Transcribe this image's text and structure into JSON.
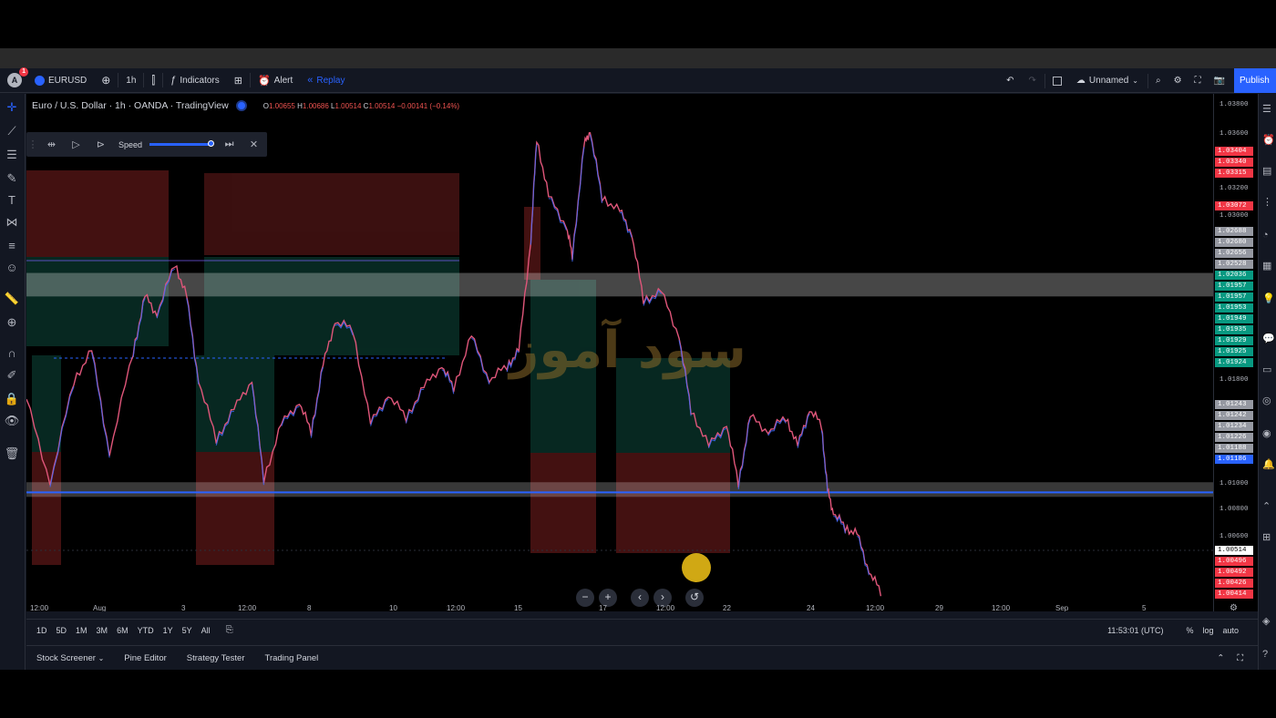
{
  "toolbar": {
    "avatar_letter": "A",
    "avatar_badge": "1",
    "symbol": "EURUSD",
    "interval": "1h",
    "indicators_label": "Indicators",
    "alert_label": "Alert",
    "replay_label": "Replay",
    "layout_name": "Unnamed",
    "publish_label": "Publish"
  },
  "legend": {
    "title": "Euro / U.S. Dollar · 1h · OANDA · TradingView",
    "o_label": "O",
    "o": "1.00655",
    "h_label": "H",
    "h": "1.00686",
    "l_label": "L",
    "l": "1.00514",
    "c_label": "C",
    "c": "1.00514",
    "change": "−0.00141 (−0.14%)"
  },
  "replay_bar": {
    "speed_label": "Speed",
    "speed_level": 1.0
  },
  "watermark": "سود آموز",
  "chart_data": {
    "type": "line",
    "ylim": [
      1.004,
      1.0385
    ],
    "price_ticks": [
      "1.03800",
      "1.03600",
      "1.03200",
      "1.03000",
      "1.01800",
      "1.01000",
      "1.00800",
      "1.00600"
    ],
    "price_tags": [
      {
        "v": "1.03404",
        "c": "#f23645"
      },
      {
        "v": "1.03340",
        "c": "#f23645"
      },
      {
        "v": "1.03315",
        "c": "#f23645"
      },
      {
        "v": "1.03072",
        "c": "#f23645"
      },
      {
        "v": "1.02688",
        "c": "#9598a1"
      },
      {
        "v": "1.02680",
        "c": "#9598a1"
      },
      {
        "v": "1.02656",
        "c": "#9598a1"
      },
      {
        "v": "1.02528",
        "c": "#9598a1"
      },
      {
        "v": "1.02036",
        "c": "#089981"
      },
      {
        "v": "1.01957",
        "c": "#089981"
      },
      {
        "v": "1.01957",
        "c": "#089981"
      },
      {
        "v": "1.01953",
        "c": "#089981"
      },
      {
        "v": "1.01949",
        "c": "#089981"
      },
      {
        "v": "1.01935",
        "c": "#089981"
      },
      {
        "v": "1.01929",
        "c": "#089981"
      },
      {
        "v": "1.01925",
        "c": "#089981"
      },
      {
        "v": "1.01924",
        "c": "#089981"
      },
      {
        "v": "1.01243",
        "c": "#9598a1"
      },
      {
        "v": "1.01242",
        "c": "#9598a1"
      },
      {
        "v": "1.01234",
        "c": "#9598a1"
      },
      {
        "v": "1.01226",
        "c": "#9598a1"
      },
      {
        "v": "1.01188",
        "c": "#9598a1"
      },
      {
        "v": "1.01186",
        "c": "#2962ff"
      },
      {
        "v": "1.00514",
        "c": "#ffffff"
      },
      {
        "v": "1.00496",
        "c": "#f23645"
      },
      {
        "v": "1.00492",
        "c": "#f23645"
      },
      {
        "v": "1.00426",
        "c": "#f23645"
      },
      {
        "v": "1.00414",
        "c": "#f23645"
      }
    ],
    "time_ticks": [
      "12:00",
      "Aug",
      "3",
      "12:00",
      "8",
      "10",
      "12:00",
      "15",
      "17",
      "12:00",
      "22",
      "24",
      "12:00",
      "29",
      "12:00",
      "Sep",
      "5"
    ],
    "price_path": [
      [
        0,
        1.0182
      ],
      [
        0.02,
        1.0125
      ],
      [
        0.04,
        1.0195
      ],
      [
        0.055,
        1.0215
      ],
      [
        0.07,
        1.0145
      ],
      [
        0.09,
        1.0215
      ],
      [
        0.1,
        1.0252
      ],
      [
        0.11,
        1.024
      ],
      [
        0.125,
        1.0275
      ],
      [
        0.135,
        1.0252
      ],
      [
        0.145,
        1.0195
      ],
      [
        0.16,
        1.0155
      ],
      [
        0.175,
        1.0175
      ],
      [
        0.19,
        1.0195
      ],
      [
        0.2,
        1.0128
      ],
      [
        0.215,
        1.0165
      ],
      [
        0.23,
        1.018
      ],
      [
        0.24,
        1.016
      ],
      [
        0.25,
        1.0205
      ],
      [
        0.26,
        1.0235
      ],
      [
        0.275,
        1.023
      ],
      [
        0.29,
        1.0165
      ],
      [
        0.305,
        1.0185
      ],
      [
        0.32,
        1.017
      ],
      [
        0.335,
        1.019
      ],
      [
        0.35,
        1.0205
      ],
      [
        0.36,
        1.019
      ],
      [
        0.375,
        1.0225
      ],
      [
        0.39,
        1.0195
      ],
      [
        0.405,
        1.0205
      ],
      [
        0.415,
        1.0215
      ],
      [
        0.425,
        1.029
      ],
      [
        0.43,
        1.036
      ],
      [
        0.44,
        1.032
      ],
      [
        0.455,
        1.03
      ],
      [
        0.46,
        1.028
      ],
      [
        0.47,
        1.0355
      ],
      [
        0.475,
        1.0365
      ],
      [
        0.485,
        1.032
      ],
      [
        0.5,
        1.031
      ],
      [
        0.51,
        1.0295
      ],
      [
        0.52,
        1.025
      ],
      [
        0.535,
        1.0255
      ],
      [
        0.55,
        1.0225
      ],
      [
        0.56,
        1.0175
      ],
      [
        0.575,
        1.015
      ],
      [
        0.59,
        1.0165
      ],
      [
        0.6,
        1.0125
      ],
      [
        0.61,
        1.017
      ],
      [
        0.625,
        1.016
      ],
      [
        0.64,
        1.017
      ],
      [
        0.65,
        1.015
      ],
      [
        0.66,
        1.0175
      ],
      [
        0.67,
        1.0165
      ],
      [
        0.675,
        1.012
      ],
      [
        0.68,
        1.0105
      ],
      [
        0.69,
        1.0095
      ],
      [
        0.7,
        1.009
      ],
      [
        0.71,
        1.0065
      ],
      [
        0.72,
        1.0051
      ]
    ]
  },
  "zones": {
    "supply_band": {
      "top": 1.0268,
      "bottom": 1.0252
    },
    "support_band": {
      "top": 1.0123,
      "bottom": 1.0118
    },
    "support_line": 1.01186
  },
  "nav": {
    "zoom_out": "−",
    "zoom_in": "+",
    "back": "‹",
    "forward": "›"
  },
  "range_bar": {
    "ranges": [
      "1D",
      "5D",
      "1M",
      "3M",
      "6M",
      "YTD",
      "1Y",
      "5Y",
      "All"
    ],
    "clock": "11:53:01 (UTC)",
    "percent": "%",
    "log": "log",
    "auto": "auto"
  },
  "panel_bar": {
    "items": [
      "Stock Screener",
      "Pine Editor",
      "Strategy Tester",
      "Trading Panel"
    ]
  }
}
